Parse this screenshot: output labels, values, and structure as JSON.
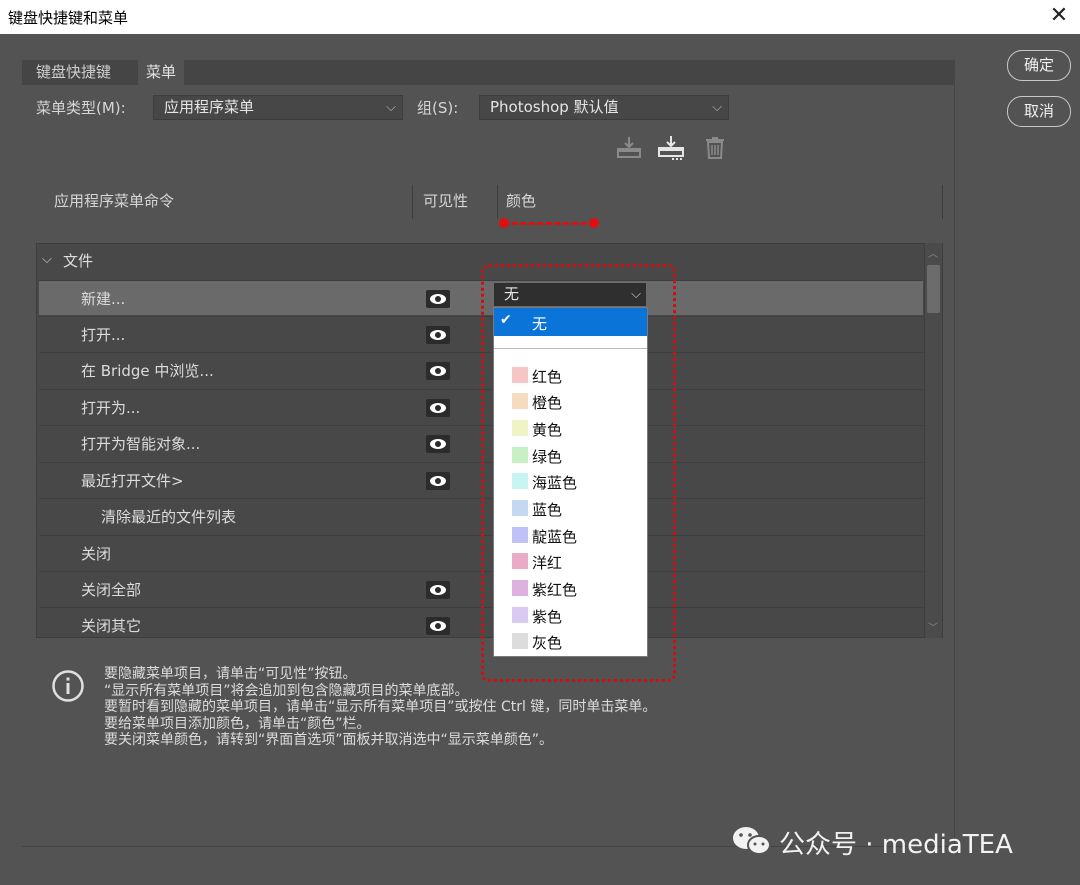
{
  "window": {
    "title": "键盘快捷键和菜单",
    "close_label": "✕"
  },
  "tabs": [
    {
      "label": "键盘快捷键"
    },
    {
      "label": "菜单"
    }
  ],
  "menu_type": {
    "label": "菜单类型(M):",
    "value": "应用程序菜单"
  },
  "group": {
    "label": "组(S):",
    "value": "Photoshop 默认值"
  },
  "toolbar": {
    "icons": [
      "save-set-icon",
      "save-as-icon",
      "delete-icon"
    ]
  },
  "columns": {
    "command": "应用程序菜单命令",
    "visibility": "可见性",
    "color": "颜色"
  },
  "tree": {
    "group_name": "文件",
    "rows": [
      {
        "name": "新建...",
        "eye": true,
        "selected": true
      },
      {
        "name": "打开...",
        "eye": true
      },
      {
        "name": "在 Bridge 中浏览...",
        "eye": true
      },
      {
        "name": "打开为...",
        "eye": true
      },
      {
        "name": "打开为智能对象...",
        "eye": true
      },
      {
        "name": "最近打开文件>",
        "eye": true
      },
      {
        "name": "清除最近的文件列表",
        "eye": false,
        "indent": true
      },
      {
        "name": "关闭",
        "eye": false
      },
      {
        "name": "关闭全部",
        "eye": true
      },
      {
        "name": "关闭其它",
        "eye": true
      }
    ]
  },
  "color_select": {
    "value": "无"
  },
  "color_options": {
    "selected": "无",
    "items": [
      {
        "name": "红色",
        "swatch": "#f4c7c6"
      },
      {
        "name": "橙色",
        "swatch": "#f5dcc1"
      },
      {
        "name": "黄色",
        "swatch": "#eff3c6"
      },
      {
        "name": "绿色",
        "swatch": "#c7f1c4"
      },
      {
        "name": "海蓝色",
        "swatch": "#c8f5f4"
      },
      {
        "name": "蓝色",
        "swatch": "#c5d8f2"
      },
      {
        "name": "靛蓝色",
        "swatch": "#bec2f4"
      },
      {
        "name": "洋红",
        "swatch": "#eaabc7"
      },
      {
        "name": "紫红色",
        "swatch": "#deb2de"
      },
      {
        "name": "紫色",
        "swatch": "#dac9f2"
      },
      {
        "name": "灰色",
        "swatch": "#dcdcdc"
      }
    ]
  },
  "info_lines": [
    "要隐藏菜单项目，请单击“可见性”按钮。",
    "“显示所有菜单项目”将会追加到包含隐藏项目的菜单底部。",
    "要暂时看到隐藏的菜单项目，请单击“显示所有菜单项目”或按住 Ctrl 键，同时单击菜单。",
    "要给菜单项目添加颜色，请单击“颜色”栏。",
    "要关闭菜单颜色，请转到“界面首选项”面板并取消选中“显示菜单颜色”。"
  ],
  "buttons": {
    "ok": "确定",
    "cancel": "取消"
  },
  "watermark": "公众号 · mediaTEA",
  "colors": {
    "annotation": "#e01010",
    "selection": "#0a74d8"
  }
}
